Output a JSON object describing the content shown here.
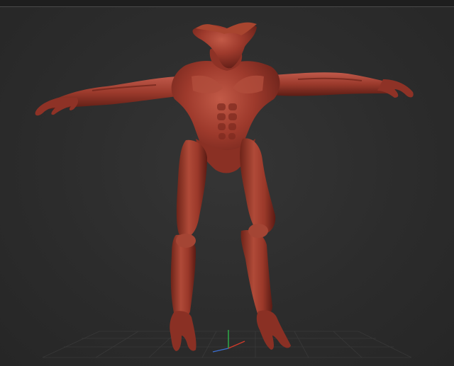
{
  "viewport": {
    "model": "sculpted-creature-mesh",
    "material_color": "#9e3a2c",
    "material_highlight": "#c9614d",
    "material_shadow": "#5e1d16",
    "background_color": "#2e2e2e",
    "floor_grid_color": "#4a4a4a",
    "gizmo": {
      "x_color": "#d23b2b",
      "y_color": "#2fb34b",
      "z_color": "#3c6fd1"
    }
  }
}
